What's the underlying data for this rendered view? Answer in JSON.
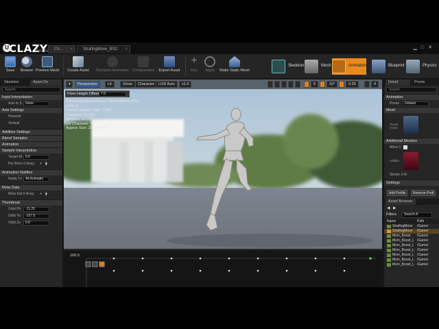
{
  "app": {
    "brand": "CLAZY",
    "brand_sub": "Animation",
    "tabs": [
      {
        "label": "Ch..."
      },
      {
        "label": "StrafingMove_BS2"
      }
    ]
  },
  "toolbar": {
    "buttons": [
      {
        "label": "Save",
        "enabled": true,
        "icon": "save-icon"
      },
      {
        "label": "Browse",
        "enabled": true,
        "icon": "browse-icon"
      },
      {
        "label": "Preview Mesh",
        "enabled": true,
        "icon": "preview-mesh-icon"
      },
      {
        "label": "Create Asset",
        "enabled": true,
        "icon": "create-asset-icon"
      },
      {
        "label": "Reimport Animation",
        "enabled": false,
        "icon": "reimport-icon"
      },
      {
        "label": "Compression",
        "enabled": false,
        "icon": "compression-icon"
      },
      {
        "label": "Export Asset",
        "enabled": true,
        "icon": "export-asset-icon"
      },
      {
        "label": "Key",
        "enabled": false,
        "icon": "key-icon"
      },
      {
        "label": "Apply",
        "enabled": false,
        "icon": "apply-icon"
      },
      {
        "label": "Make Static Mesh",
        "enabled": true,
        "icon": "static-mesh-icon"
      }
    ],
    "modes": [
      {
        "label": "Skeleton",
        "icon": "skeleton-mode-icon"
      },
      {
        "label": "Mesh",
        "icon": "mesh-mode-icon"
      },
      {
        "label": "Animation",
        "icon": "animation-mode-icon",
        "active": true
      },
      {
        "label": "Blueprint",
        "icon": "blueprint-mode-icon"
      },
      {
        "label": "Physics",
        "icon": "physics-mode-icon"
      }
    ]
  },
  "left_panel": {
    "tabs": [
      "Skeleton",
      "Asset De"
    ],
    "search_placeholder": "Search",
    "sections": {
      "input_interpolation": "Input Interpolation",
      "axis_to_scale": "Axis to S",
      "axis_to_scale_value": "None",
      "axis_settings": "Axis Settings",
      "horizontal": "Horizont",
      "vertical": "Vertical",
      "additive_settings": "Additive Settings",
      "blend_samples": "Blend Samples",
      "animation": "Animation",
      "sample_interpolation": "Sample Interpolation",
      "target_weight": "Target W",
      "target_weight_value": "0.0",
      "per_bone": "Per Bone 0 Array",
      "animation_notifies": "Animation Notifies",
      "notify_trigger": "Notify Tri",
      "notify_trigger_value": "All Animatio",
      "meta_data": "Meta Data",
      "meta_data_array": "Meta Dat 0 Array",
      "thumbnail": "Thumbnail",
      "orbit_pitch": "Orbit Pit",
      "orbit_pitch_value": "-11.25",
      "orbit_yaw": "Orbit Ya",
      "orbit_yaw_value": "-157.5",
      "orbit_zoom": "Orbit Zo",
      "orbit_zoom_value": "0.0"
    }
  },
  "viewport": {
    "toolbar": {
      "perspective": "Perspective",
      "lit": "Lit",
      "show": "Show",
      "character": "Character",
      "lod": "LOD Auto",
      "speed": "x1.0",
      "grid_value": "5",
      "angle_value": "10°",
      "scale_value": "0.25",
      "camera_speed": "4"
    },
    "floor_height_offset_label": "Floor Height Offset",
    "floor_height_offset_value": "7.0",
    "stats": [
      "Previewing Blend Space StrafingMove_BS2",
      "LOD: 0",
      "Current Screen Size: 1.356",
      "Triangles: 41,052",
      "Vertices: 23,297",
      "UV Channels: 1",
      "Approx Size: 277x87x303"
    ]
  },
  "blend_space": {
    "value_label": "100.0"
  },
  "right_panel": {
    "tabs": [
      "Detail",
      "Previe"
    ],
    "search_placeholder": "Search",
    "animation_section": "Animation",
    "preview_label": "Previe",
    "preview_value": "Default",
    "mesh_section": "Mesh",
    "preview_mesh_label": "Previe (Anim",
    "additional_meshes_section": "Additional Meshes",
    "allow_label": "Allow C",
    "additional_label": "Additio",
    "skeletal_label": "Skelet: 0 Ar",
    "settings_section": "Settings",
    "add_profile": "Add Profile",
    "remove_profile": "Remove Profi",
    "asset_browser_tab": "Asset Browser",
    "filters_label": "Filters",
    "asset_search_placeholder": "Search A",
    "col_name": "Name",
    "col_path": "Path",
    "assets": [
      {
        "name": "StrafingMove",
        "path": "/Game/",
        "selected": false
      },
      {
        "name": "StrafingMove",
        "path": "/Game/",
        "selected": true
      },
      {
        "name": "Mvm_Boost",
        "path": "/Game/",
        "selected": false
      },
      {
        "name": "Mvm_Boost_L",
        "path": "/Game/",
        "selected": false
      },
      {
        "name": "Mvm_Boost_L",
        "path": "/Game/",
        "selected": false
      },
      {
        "name": "Mvm_Boost_L",
        "path": "/Game/",
        "selected": false
      },
      {
        "name": "Mvm_Boost_L",
        "path": "/Game/",
        "selected": false
      },
      {
        "name": "Mvm_Boost_L",
        "path": "/Game/",
        "selected": false
      },
      {
        "name": "Mvm_Boost_L",
        "path": "/Game/",
        "selected": false
      }
    ]
  },
  "colors": {
    "accent": "#e98a1e",
    "panel": "#262626",
    "selected": "#5a4320"
  }
}
